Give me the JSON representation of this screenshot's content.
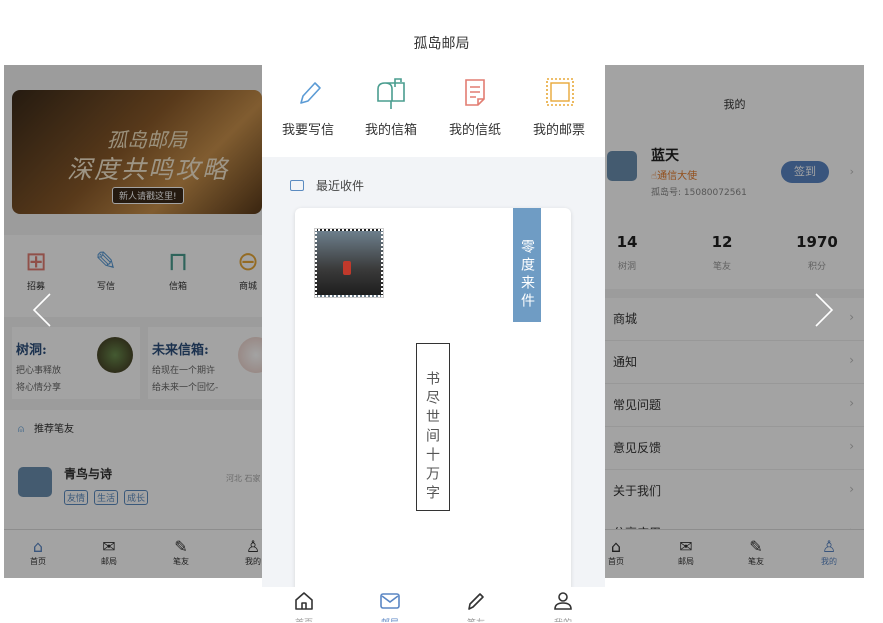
{
  "page_title": "孤岛邮局",
  "left": {
    "banner": {
      "line1": "孤岛邮局",
      "line2": "深度共鸣攻略",
      "tag": "新人请戳这里!"
    },
    "grid": [
      {
        "label": "招募",
        "icon": "recruit-icon"
      },
      {
        "label": "写信",
        "icon": "pencil-icon"
      },
      {
        "label": "信箱",
        "icon": "mailbox-icon"
      },
      {
        "label": "商城",
        "icon": "shop-icon"
      }
    ],
    "cards": [
      {
        "title": "树洞:",
        "line1": "把心事释放",
        "line2": "将心情分享"
      },
      {
        "title": "未来信箱:",
        "line1": "给现在一个期许",
        "line2": "给未来一个回忆-"
      }
    ],
    "recommend": "推荐笔友",
    "friend": {
      "name": "青鸟与诗",
      "tags": [
        "友情",
        "生活",
        "成长"
      ],
      "location": "河北 石家"
    },
    "nav": [
      "首页",
      "邮局",
      "笔友",
      "我的"
    ]
  },
  "center": {
    "actions": [
      {
        "label": "我要写信",
        "icon": "pencil-icon",
        "color": "#5b9bd5"
      },
      {
        "label": "我的信箱",
        "icon": "mailbox-icon",
        "color": "#4a9d8f"
      },
      {
        "label": "我的信纸",
        "icon": "letter-paper-icon",
        "color": "#e27d72"
      },
      {
        "label": "我的邮票",
        "icon": "stamp-icon",
        "color": "#e8a838"
      }
    ],
    "recent_title": "最近收件",
    "letter": {
      "sender": "零度来件",
      "content": "书尽世间十万字"
    },
    "nav": [
      "首页",
      "邮局",
      "笔友",
      "我的"
    ],
    "active_nav": "邮局"
  },
  "right": {
    "header": "我的",
    "user": {
      "name": "蓝天",
      "badge": "通信大使",
      "id": "孤岛号: 15080072561",
      "signin": "签到"
    },
    "stats": [
      {
        "value": "14",
        "label": "树洞"
      },
      {
        "value": "12",
        "label": "笔友"
      },
      {
        "value": "1970",
        "label": "积分"
      }
    ],
    "menu": [
      "商城",
      "通知",
      "常见问题",
      "意见反馈",
      "关于我们",
      "分享应用"
    ],
    "nav": [
      "首页",
      "邮局",
      "笔友",
      "我的"
    ],
    "accent": "#5a86c4"
  }
}
